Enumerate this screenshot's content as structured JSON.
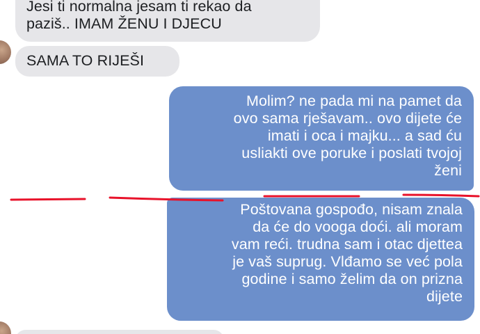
{
  "messages": [
    {
      "direction": "incoming",
      "lines": [
        "Jesi ti normalna jesam ti rekao da",
        "paziš.. IMAM ŽENU I DJECU"
      ]
    },
    {
      "direction": "incoming",
      "lines": [
        "SAMA TO RIJEŠI"
      ]
    },
    {
      "direction": "outgoing",
      "lines": [
        "Molim? ne pada mi na pamet da",
        "ovo sama rješavam.. ovo dijete će",
        "imati i oca i majku... a sad ću",
        "usliakti ove poruke i poslati tvojoj",
        "ženi"
      ]
    },
    {
      "direction": "outgoing",
      "lines": [
        "Poštovana gospođo, nisam znala",
        "da će do vooga doći. ali moram",
        "vam reći. trudna sam i otac djettea",
        "je vaš suprug. Vlđamo se već pola",
        "godine i samo želim da on prizna",
        "dijete"
      ]
    }
  ],
  "colors": {
    "incoming_bubble": "#e6e6e9",
    "outgoing_bubble": "#6c8fcb",
    "annotation_line": "#e8122a"
  }
}
